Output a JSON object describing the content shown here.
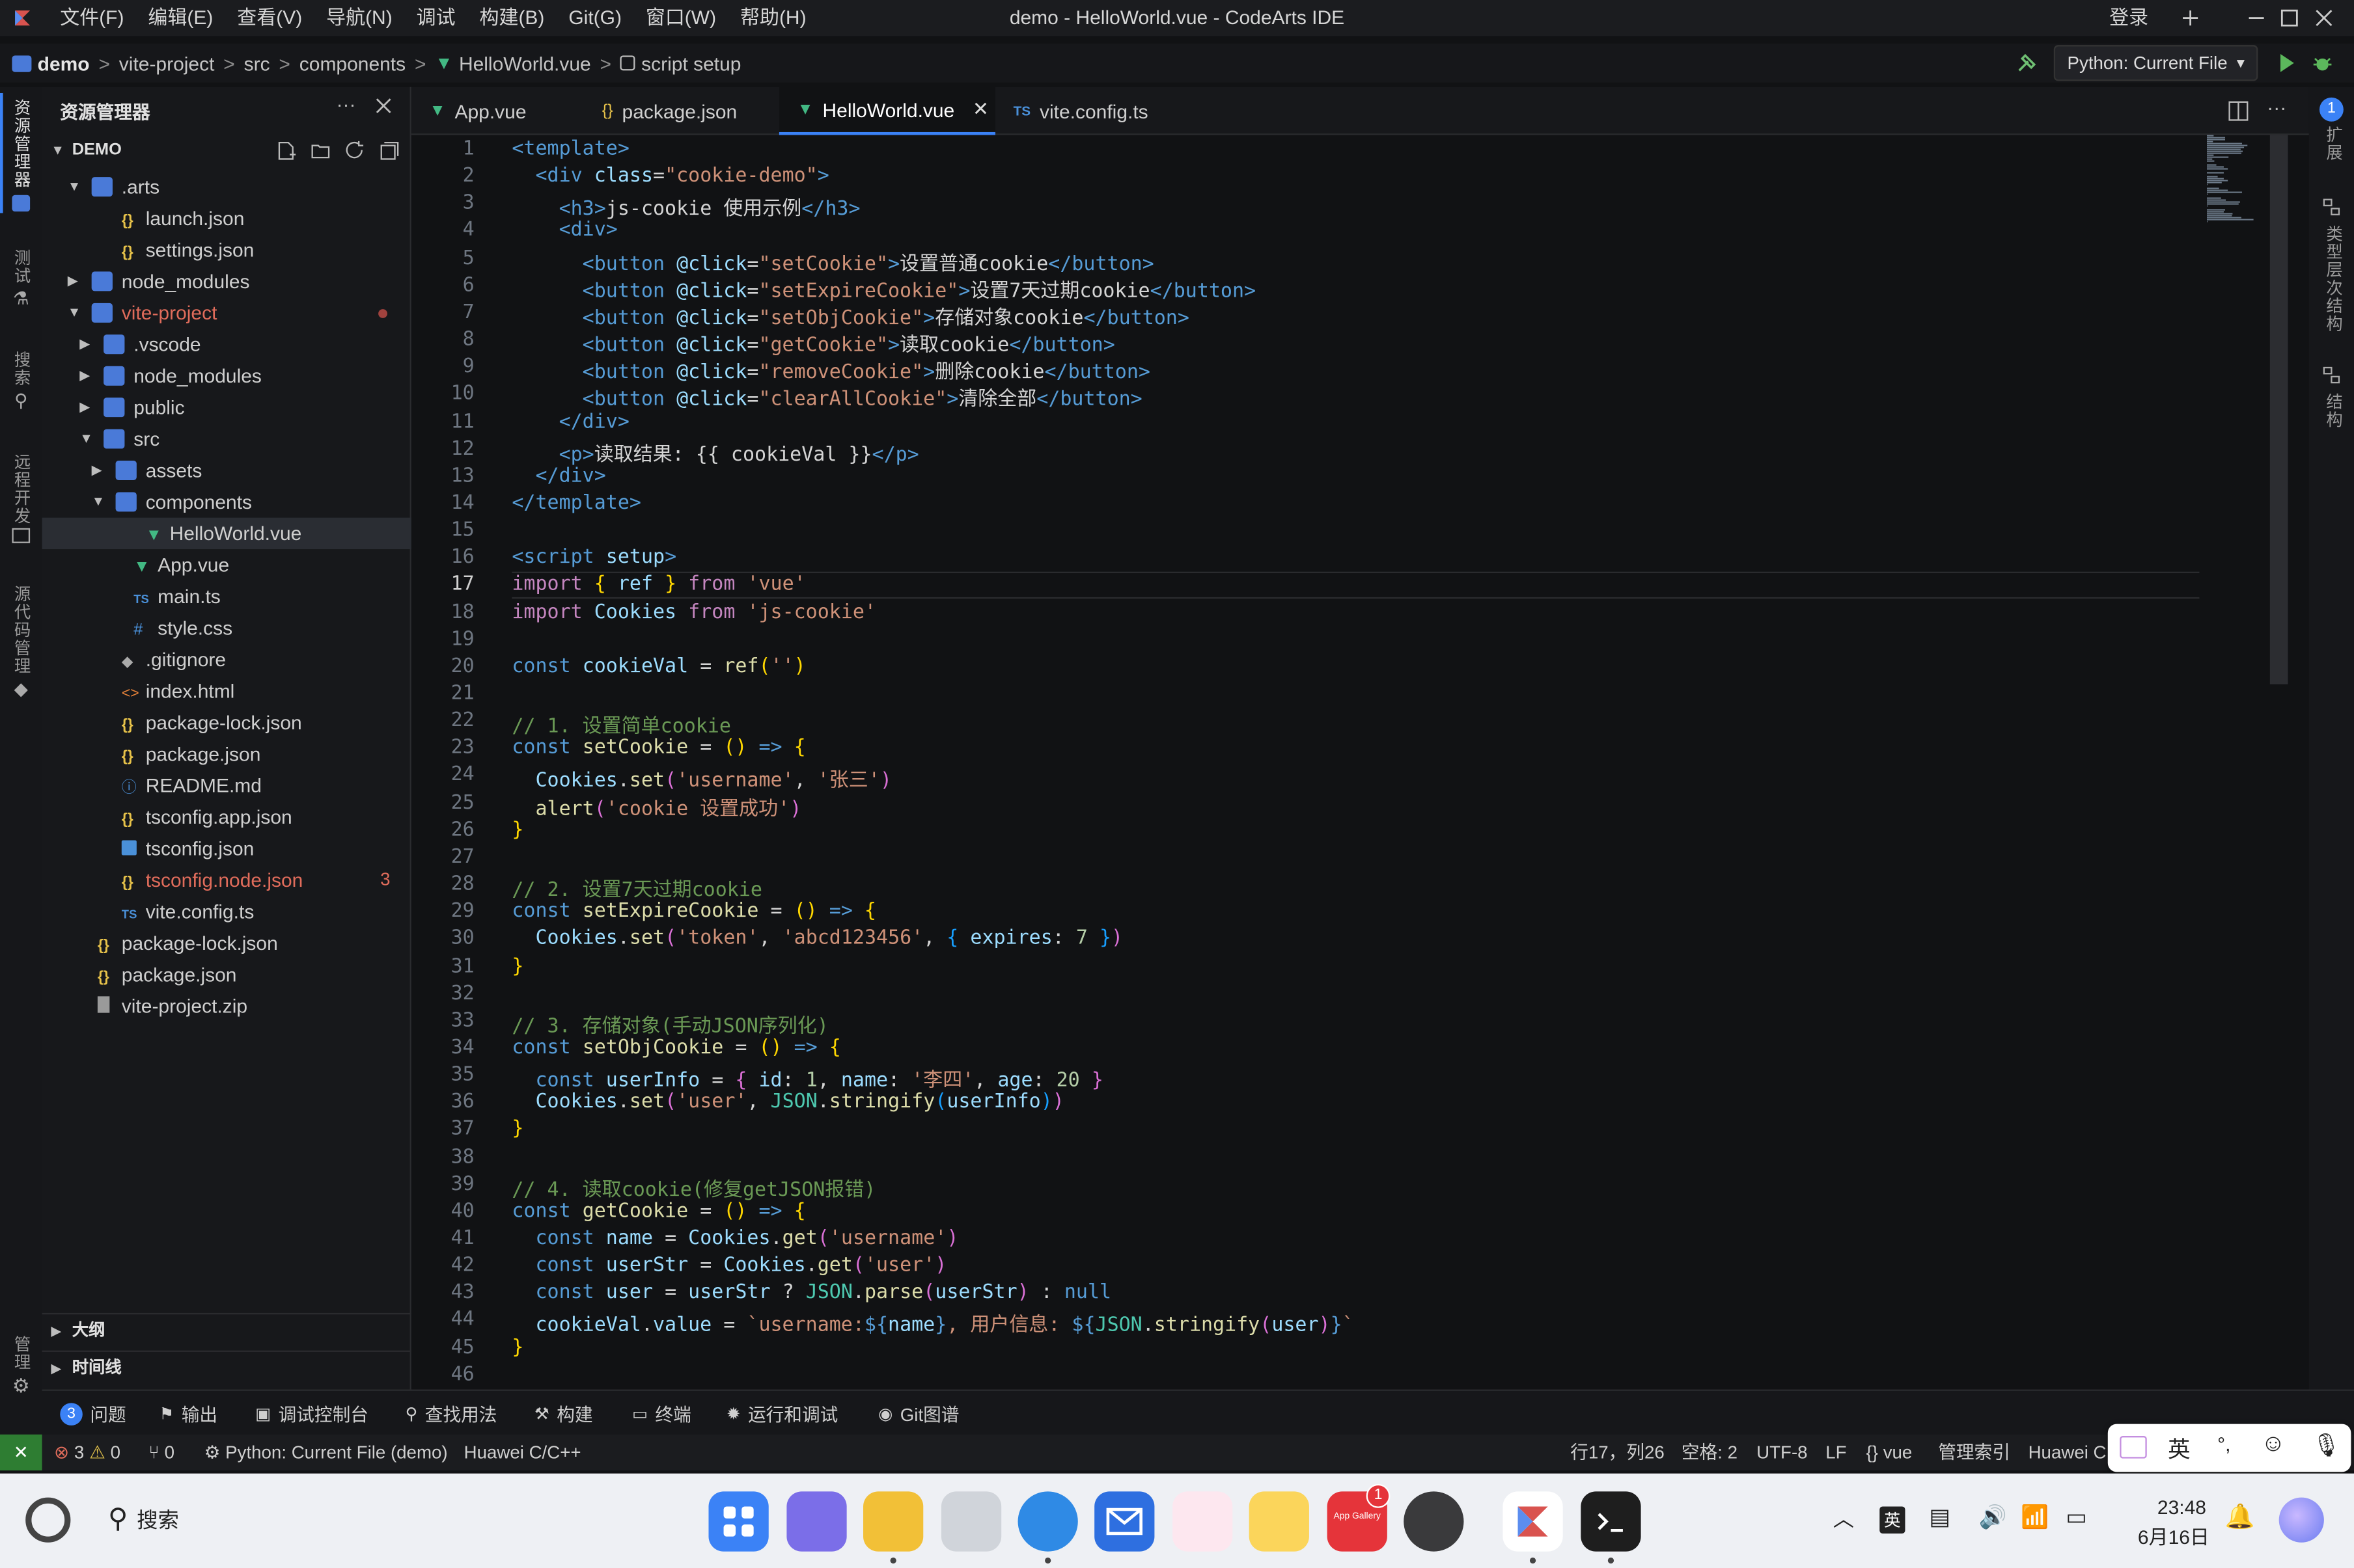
{
  "window": {
    "title": "demo - HelloWorld.vue - CodeArts IDE",
    "login": "登录"
  },
  "menu": [
    "文件(F)",
    "编辑(E)",
    "查看(V)",
    "导航(N)",
    "调试",
    "构建(B)",
    "Git(G)",
    "窗口(W)",
    "帮助(H)"
  ],
  "breadcrumb": [
    "demo",
    "vite-project",
    "src",
    "components",
    "HelloWorld.vue",
    "script setup"
  ],
  "run_config": "Python: Current File",
  "activity": [
    "资源管理器",
    "测试",
    "搜索",
    "远程开发",
    "源代码管理",
    "管理"
  ],
  "right_activity": [
    "扩展",
    "类型层次结构",
    "结构"
  ],
  "right_badge": "1",
  "explorer": {
    "title": "资源管理器",
    "root": "DEMO",
    "tree": [
      {
        "label": ".arts",
        "depth": 1,
        "type": "folder",
        "open": true
      },
      {
        "label": "launch.json",
        "depth": 2,
        "type": "json"
      },
      {
        "label": "settings.json",
        "depth": 2,
        "type": "json"
      },
      {
        "label": "node_modules",
        "depth": 1,
        "type": "folder",
        "open": false
      },
      {
        "label": "vite-project",
        "depth": 1,
        "type": "folder",
        "open": true,
        "modified": true
      },
      {
        "label": ".vscode",
        "depth": 2,
        "type": "folder",
        "open": false
      },
      {
        "label": "node_modules",
        "depth": 2,
        "type": "folder",
        "open": false
      },
      {
        "label": "public",
        "depth": 2,
        "type": "folder",
        "open": false
      },
      {
        "label": "src",
        "depth": 2,
        "type": "folder",
        "open": true
      },
      {
        "label": "assets",
        "depth": 3,
        "type": "folder",
        "open": false
      },
      {
        "label": "components",
        "depth": 3,
        "type": "folder",
        "open": true
      },
      {
        "label": "HelloWorld.vue",
        "depth": 4,
        "type": "vue",
        "selected": true
      },
      {
        "label": "App.vue",
        "depth": 3,
        "type": "vue"
      },
      {
        "label": "main.ts",
        "depth": 3,
        "type": "ts"
      },
      {
        "label": "style.css",
        "depth": 3,
        "type": "css"
      },
      {
        "label": ".gitignore",
        "depth": 2,
        "type": "git"
      },
      {
        "label": "index.html",
        "depth": 2,
        "type": "html"
      },
      {
        "label": "package-lock.json",
        "depth": 2,
        "type": "json"
      },
      {
        "label": "package.json",
        "depth": 2,
        "type": "json"
      },
      {
        "label": "README.md",
        "depth": 2,
        "type": "info"
      },
      {
        "label": "tsconfig.app.json",
        "depth": 2,
        "type": "json"
      },
      {
        "label": "tsconfig.json",
        "depth": 2,
        "type": "tsconfig"
      },
      {
        "label": "tsconfig.node.json",
        "depth": 2,
        "type": "json",
        "error": true,
        "count": "3"
      },
      {
        "label": "vite.config.ts",
        "depth": 2,
        "type": "ts"
      },
      {
        "label": "package-lock.json",
        "depth": 1,
        "type": "json"
      },
      {
        "label": "package.json",
        "depth": 1,
        "type": "json"
      },
      {
        "label": "vite-project.zip",
        "depth": 1,
        "type": "zip"
      }
    ],
    "outline": "大纲",
    "timeline": "时间线"
  },
  "tabs": [
    {
      "label": "App.vue",
      "type": "vue"
    },
    {
      "label": "package.json",
      "type": "json"
    },
    {
      "label": "HelloWorld.vue",
      "type": "vue",
      "active": true
    },
    {
      "label": "vite.config.ts",
      "type": "ts"
    }
  ],
  "editor": {
    "current_line": 17,
    "lines": [
      [
        [
          "t-tag",
          "<template>"
        ]
      ],
      [
        [
          "t-tag",
          "  <div "
        ],
        [
          "t-attr",
          "class"
        ],
        [
          "t-br",
          "="
        ],
        [
          "t-str",
          "\"cookie-demo\""
        ],
        [
          "t-tag",
          ">"
        ]
      ],
      [
        [
          "t-tag",
          "    <h3>"
        ],
        [
          "t-txt",
          "js-cookie 使用示例"
        ],
        [
          "t-tag",
          "</h3>"
        ]
      ],
      [
        [
          "t-tag",
          "    <div>"
        ]
      ],
      [
        [
          "t-tag",
          "      <button "
        ],
        [
          "t-attr",
          "@click"
        ],
        [
          "t-br",
          "="
        ],
        [
          "t-str",
          "\"setCookie\""
        ],
        [
          "t-tag",
          ">"
        ],
        [
          "t-txt",
          "设置普通cookie"
        ],
        [
          "t-tag",
          "</button>"
        ]
      ],
      [
        [
          "t-tag",
          "      <button "
        ],
        [
          "t-attr",
          "@click"
        ],
        [
          "t-br",
          "="
        ],
        [
          "t-str",
          "\"setExpireCookie\""
        ],
        [
          "t-tag",
          ">"
        ],
        [
          "t-txt",
          "设置7天过期cookie"
        ],
        [
          "t-tag",
          "</button>"
        ]
      ],
      [
        [
          "t-tag",
          "      <button "
        ],
        [
          "t-attr",
          "@click"
        ],
        [
          "t-br",
          "="
        ],
        [
          "t-str",
          "\"setObjCookie\""
        ],
        [
          "t-tag",
          ">"
        ],
        [
          "t-txt",
          "存储对象cookie"
        ],
        [
          "t-tag",
          "</button>"
        ]
      ],
      [
        [
          "t-tag",
          "      <button "
        ],
        [
          "t-attr",
          "@click"
        ],
        [
          "t-br",
          "="
        ],
        [
          "t-str",
          "\"getCookie\""
        ],
        [
          "t-tag",
          ">"
        ],
        [
          "t-txt",
          "读取cookie"
        ],
        [
          "t-tag",
          "</button>"
        ]
      ],
      [
        [
          "t-tag",
          "      <button "
        ],
        [
          "t-attr",
          "@click"
        ],
        [
          "t-br",
          "="
        ],
        [
          "t-str",
          "\"removeCookie\""
        ],
        [
          "t-tag",
          ">"
        ],
        [
          "t-txt",
          "删除cookie"
        ],
        [
          "t-tag",
          "</button>"
        ]
      ],
      [
        [
          "t-tag",
          "      <button "
        ],
        [
          "t-attr",
          "@click"
        ],
        [
          "t-br",
          "="
        ],
        [
          "t-str",
          "\"clearAllCookie\""
        ],
        [
          "t-tag",
          ">"
        ],
        [
          "t-txt",
          "清除全部"
        ],
        [
          "t-tag",
          "</button>"
        ]
      ],
      [
        [
          "t-tag",
          "    </div>"
        ]
      ],
      [
        [
          "t-tag",
          "    <p>"
        ],
        [
          "t-txt",
          "读取结果: {{ cookieVal }}"
        ],
        [
          "t-tag",
          "</p>"
        ]
      ],
      [
        [
          "t-tag",
          "  </div>"
        ]
      ],
      [
        [
          "t-tag",
          "</template>"
        ]
      ],
      [],
      [
        [
          "t-tag",
          "<script "
        ],
        [
          "t-attr",
          "setup"
        ],
        [
          "t-tag",
          ">"
        ]
      ],
      [
        [
          "t-imp",
          "import"
        ],
        [
          "t-br",
          " "
        ],
        [
          "t-y",
          "{"
        ],
        [
          "t-var",
          " ref "
        ],
        [
          "t-y",
          "}"
        ],
        [
          "t-imp",
          " from "
        ],
        [
          "t-str",
          "'vue'"
        ]
      ],
      [
        [
          "t-imp",
          "import"
        ],
        [
          "t-var",
          " Cookies"
        ],
        [
          "t-imp",
          " from "
        ],
        [
          "t-str",
          "'js-cookie'"
        ]
      ],
      [],
      [
        [
          "t-kw",
          "const"
        ],
        [
          "t-var",
          " cookieVal"
        ],
        [
          "t-br",
          " = "
        ],
        [
          "t-fn",
          "ref"
        ],
        [
          "t-y",
          "("
        ],
        [
          "t-str",
          "''"
        ],
        [
          "t-y",
          ")"
        ]
      ],
      [],
      [
        [
          "t-com",
          "// 1. 设置简单cookie"
        ]
      ],
      [
        [
          "t-kw",
          "const"
        ],
        [
          "t-fn",
          " setCookie"
        ],
        [
          "t-br",
          " = "
        ],
        [
          "t-y",
          "()"
        ],
        [
          "t-kw",
          " =>"
        ],
        [
          "t-y",
          " {"
        ]
      ],
      [
        [
          "t-var",
          "  Cookies"
        ],
        [
          "t-br",
          "."
        ],
        [
          "t-fn",
          "set"
        ],
        [
          "t-p",
          "("
        ],
        [
          "t-str",
          "'username'"
        ],
        [
          "t-br",
          ", "
        ],
        [
          "t-str",
          "'张三'"
        ],
        [
          "t-p",
          ")"
        ]
      ],
      [
        [
          "t-fn",
          "  alert"
        ],
        [
          "t-p",
          "("
        ],
        [
          "t-str",
          "'cookie 设置成功'"
        ],
        [
          "t-p",
          ")"
        ]
      ],
      [
        [
          "t-y",
          "}"
        ]
      ],
      [],
      [
        [
          "t-com",
          "// 2. 设置7天过期cookie"
        ]
      ],
      [
        [
          "t-kw",
          "const"
        ],
        [
          "t-fn",
          " setExpireCookie"
        ],
        [
          "t-br",
          " = "
        ],
        [
          "t-y",
          "()"
        ],
        [
          "t-kw",
          " =>"
        ],
        [
          "t-y",
          " {"
        ]
      ],
      [
        [
          "t-var",
          "  Cookies"
        ],
        [
          "t-br",
          "."
        ],
        [
          "t-fn",
          "set"
        ],
        [
          "t-p",
          "("
        ],
        [
          "t-str",
          "'token'"
        ],
        [
          "t-br",
          ", "
        ],
        [
          "t-str",
          "'abcd123456'"
        ],
        [
          "t-br",
          ", "
        ],
        [
          "t-b",
          "{"
        ],
        [
          "t-var",
          " expires"
        ],
        [
          "t-br",
          ": "
        ],
        [
          "t-num",
          "7"
        ],
        [
          "t-b",
          " }"
        ],
        [
          "t-p",
          ")"
        ]
      ],
      [
        [
          "t-y",
          "}"
        ]
      ],
      [],
      [
        [
          "t-com",
          "// 3. 存储对象(手动JSON序列化)"
        ]
      ],
      [
        [
          "t-kw",
          "const"
        ],
        [
          "t-fn",
          " setObjCookie"
        ],
        [
          "t-br",
          " = "
        ],
        [
          "t-y",
          "()"
        ],
        [
          "t-kw",
          " =>"
        ],
        [
          "t-y",
          " {"
        ]
      ],
      [
        [
          "t-kw",
          "  const"
        ],
        [
          "t-var",
          " userInfo"
        ],
        [
          "t-br",
          " = "
        ],
        [
          "t-p",
          "{"
        ],
        [
          "t-var",
          " id"
        ],
        [
          "t-br",
          ": "
        ],
        [
          "t-num",
          "1"
        ],
        [
          "t-br",
          ", "
        ],
        [
          "t-var",
          "name"
        ],
        [
          "t-br",
          ": "
        ],
        [
          "t-str",
          "'李四'"
        ],
        [
          "t-br",
          ", "
        ],
        [
          "t-var",
          "age"
        ],
        [
          "t-br",
          ": "
        ],
        [
          "t-num",
          "20"
        ],
        [
          "t-p",
          " }"
        ]
      ],
      [
        [
          "t-var",
          "  Cookies"
        ],
        [
          "t-br",
          "."
        ],
        [
          "t-fn",
          "set"
        ],
        [
          "t-p",
          "("
        ],
        [
          "t-str",
          "'user'"
        ],
        [
          "t-br",
          ", "
        ],
        [
          "t-cls",
          "JSON"
        ],
        [
          "t-br",
          "."
        ],
        [
          "t-fn",
          "stringify"
        ],
        [
          "t-b",
          "("
        ],
        [
          "t-var",
          "userInfo"
        ],
        [
          "t-b",
          ")"
        ],
        [
          "t-p",
          ")"
        ]
      ],
      [
        [
          "t-y",
          "}"
        ]
      ],
      [],
      [
        [
          "t-com",
          "// 4. 读取cookie(修复getJSON报错)"
        ]
      ],
      [
        [
          "t-kw",
          "const"
        ],
        [
          "t-fn",
          " getCookie"
        ],
        [
          "t-br",
          " = "
        ],
        [
          "t-y",
          "()"
        ],
        [
          "t-kw",
          " =>"
        ],
        [
          "t-y",
          " {"
        ]
      ],
      [
        [
          "t-kw",
          "  const"
        ],
        [
          "t-var",
          " name"
        ],
        [
          "t-br",
          " = "
        ],
        [
          "t-var",
          "Cookies"
        ],
        [
          "t-br",
          "."
        ],
        [
          "t-fn",
          "get"
        ],
        [
          "t-p",
          "("
        ],
        [
          "t-str",
          "'username'"
        ],
        [
          "t-p",
          ")"
        ]
      ],
      [
        [
          "t-kw",
          "  const"
        ],
        [
          "t-var",
          " userStr"
        ],
        [
          "t-br",
          " = "
        ],
        [
          "t-var",
          "Cookies"
        ],
        [
          "t-br",
          "."
        ],
        [
          "t-fn",
          "get"
        ],
        [
          "t-p",
          "("
        ],
        [
          "t-str",
          "'user'"
        ],
        [
          "t-p",
          ")"
        ]
      ],
      [
        [
          "t-kw",
          "  const"
        ],
        [
          "t-var",
          " user"
        ],
        [
          "t-br",
          " = "
        ],
        [
          "t-var",
          "userStr"
        ],
        [
          "t-br",
          " ? "
        ],
        [
          "t-cls",
          "JSON"
        ],
        [
          "t-br",
          "."
        ],
        [
          "t-fn",
          "parse"
        ],
        [
          "t-p",
          "("
        ],
        [
          "t-var",
          "userStr"
        ],
        [
          "t-p",
          ")"
        ],
        [
          "t-br",
          " : "
        ],
        [
          "t-kw",
          "null"
        ]
      ],
      [
        [
          "t-var",
          "  cookieVal"
        ],
        [
          "t-br",
          "."
        ],
        [
          "t-var",
          "value"
        ],
        [
          "t-br",
          " = "
        ],
        [
          "t-str",
          "`username:"
        ],
        [
          "t-kw",
          "${"
        ],
        [
          "t-var",
          "name"
        ],
        [
          "t-kw",
          "}"
        ],
        [
          "t-str",
          ", 用户信息: "
        ],
        [
          "t-kw",
          "${"
        ],
        [
          "t-cls",
          "JSON"
        ],
        [
          "t-br",
          "."
        ],
        [
          "t-fn",
          "stringify"
        ],
        [
          "t-p",
          "("
        ],
        [
          "t-var",
          "user"
        ],
        [
          "t-p",
          ")"
        ],
        [
          "t-kw",
          "}"
        ],
        [
          "t-str",
          "`"
        ]
      ],
      [
        [
          "t-y",
          "}"
        ]
      ],
      []
    ]
  },
  "panel_tabs": [
    {
      "label": "问题",
      "badge": "3"
    },
    {
      "label": "输出"
    },
    {
      "label": "调试控制台"
    },
    {
      "label": "查找用法"
    },
    {
      "label": "构建"
    },
    {
      "label": "终端"
    },
    {
      "label": "运行和调试"
    },
    {
      "label": "Git图谱"
    }
  ],
  "status": {
    "errors": "3",
    "warnings": "0",
    "ports": "0",
    "run": "Python: Current File (demo)",
    "lang_ext": "Huawei C/C++",
    "cursor": "行17，列26",
    "indent": "空格: 2",
    "encoding": "UTF-8",
    "eol": "LF",
    "mode": "vue",
    "index": "管理索引",
    "huawei": "Huawei C"
  },
  "ime": {
    "lang": "英",
    "punct": "°,"
  },
  "taskbar": {
    "search": "搜索",
    "time": "23:48",
    "date": "6月16日",
    "appgallery_badge": "1",
    "ime_tray": "英",
    "appgallery_label": "App Gallery"
  },
  "colors": {
    "accent": "#3b82f6",
    "error": "#e06c5b",
    "vue": "#42b883"
  }
}
